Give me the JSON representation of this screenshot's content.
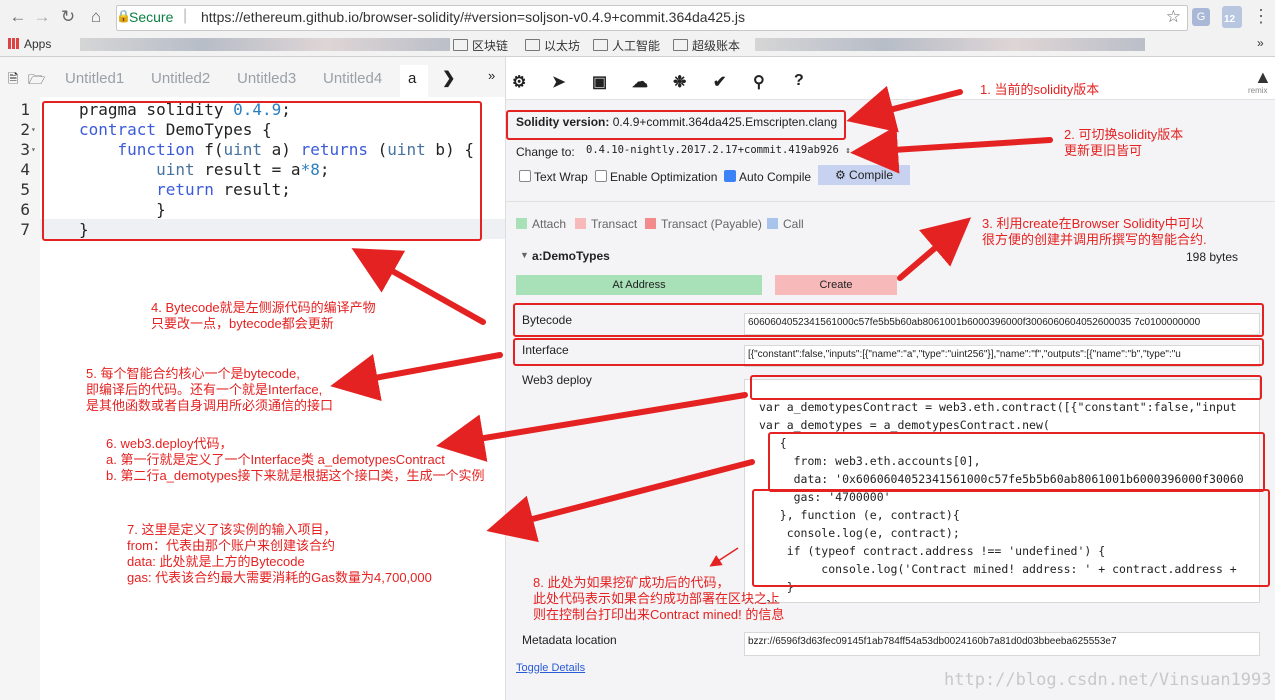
{
  "browser": {
    "secure_label": "Secure",
    "url": "https://ethereum.github.io/browser-solidity/#version=soljson-v0.4.9+commit.364da425.js",
    "bookmarks": [
      {
        "label": "Apps"
      },
      {
        "label": "区块链"
      },
      {
        "label": "以太坊"
      },
      {
        "label": "人工智能"
      },
      {
        "label": "超级账本"
      }
    ],
    "bookmarks_more": "»",
    "badge": "12"
  },
  "editor": {
    "tabs": [
      "Untitled1",
      "Untitled2",
      "Untitled3",
      "Untitled4",
      "a"
    ],
    "tab_more": "»",
    "line_numbers": [
      "1",
      "2",
      "3",
      "4",
      "5",
      "6",
      "7"
    ],
    "code": {
      "l1_pre": "pragma solidity ",
      "l1_ver": "0.4.9",
      "l1_post": ";",
      "l2_kw": "contract",
      "l2_rest": " DemoTypes {",
      "l3_indent": "    ",
      "l3_kw": "function",
      "l3_mid": " f(",
      "l3_ty": "uint",
      "l3_arg": " a) ",
      "l3_kw2": "returns",
      "l3_mid2": " (",
      "l3_ty2": "uint",
      "l3_end": " b) {",
      "l4_indent": "        ",
      "l4_ty": "uint",
      "l4_rest": " result = a",
      "l4_op": "*8",
      "l4_end": ";",
      "l5_indent": "        ",
      "l5_kw": "return",
      "l5_rest": " result;",
      "l6": "        }",
      "l7": "}"
    }
  },
  "remix_label": "remix",
  "compiler": {
    "version_label": "Solidity version:",
    "version_value": "0.4.9+commit.364da425.Emscripten.clang",
    "change_to_label": "Change to:",
    "change_to_value": "0.4.10-nightly.2017.2.17+commit.419ab926",
    "text_wrap": "Text Wrap",
    "enable_optimization": "Enable Optimization",
    "auto_compile": "Auto Compile",
    "compile": "Compile"
  },
  "run": {
    "legend": [
      "Attach",
      "Transact",
      "Transact (Payable)",
      "Call"
    ],
    "contract_name": "a:DemoTypes",
    "size": "198 bytes",
    "at_address": "At Address",
    "create": "Create",
    "bytecode_label": "Bytecode",
    "bytecode_value": "6060604052341561000c57fe5b5b60ab8061001b6000396000f3006060604052600035 7c0100000000",
    "interface_label": "Interface",
    "interface_value": "[{\"constant\":false,\"inputs\":[{\"name\":\"a\",\"type\":\"uint256\"}],\"name\":\"f\",\"outputs\":[{\"name\":\"b\",\"type\":\"u",
    "web3_label": "Web3 deploy",
    "web3_lines": [
      "var a_demotypesContract = web3.eth.contract([{\"constant\":false,\"input",
      "var a_demotypes = a_demotypesContract.new(",
      "   {",
      "     from: web3.eth.accounts[0],",
      "     data: '0x6060604052341561000c57fe5b5b60ab8061001b6000396000f30060",
      "     gas: '4700000'",
      "   }, function (e, contract){",
      "    console.log(e, contract);",
      "    if (typeof contract.address !== 'undefined') {",
      "         console.log('Contract mined! address: ' + contract.address +",
      "    }",
      " })"
    ],
    "metadata_label": "Metadata location",
    "metadata_value": "bzzr://6596f3d63fec09145f1ab784ff54a53db0024160b7a81d0d03bbeeba625553e7",
    "toggle_details": "Toggle Details"
  },
  "annotations": {
    "n1": "1. 当前的solidity版本",
    "n2": "2. 可切换solidity版本\n更新更旧皆可",
    "n3": "3. 利用create在Browser Solidity中可以\n很方便的创建并调用所撰写的智能合约.",
    "n4": "4. Bytecode就是左侧源代码的编译产物\n只要改一点，bytecode都会更新",
    "n5": "5. 每个智能合约核心一个是bytecode,\n即编译后的代码。还有一个就是Interface,\n是其他函数或者自身调用所必须通信的接口",
    "n6": "6. web3.deploy代码，\na. 第一行就是定义了一个Interface类 a_demotypesContract\nb. 第二行a_demotypes接下来就是根据这个接口类，生成一个实例",
    "n7": "7. 这里是定义了该实例的输入项目，\nfrom：代表由那个账户来创建该合约\ndata: 此处就是上方的Bytecode\ngas: 代表该合约最大需要消耗的Gas数量为4,700,000",
    "n8": "8. 此处为如果挖矿成功后的代码，\n此处代码表示如果合约成功部署在区块之上\n则在控制台打印出来Contract mined! 的信息"
  },
  "colors": {
    "annotation_red": "#e52222",
    "attach": "#a8e0b8",
    "transact": "#f7b9b9",
    "payable": "#f28c8c",
    "call": "#a9c4ec"
  },
  "watermark": "http://blog.csdn.net/Vinsuan1993"
}
